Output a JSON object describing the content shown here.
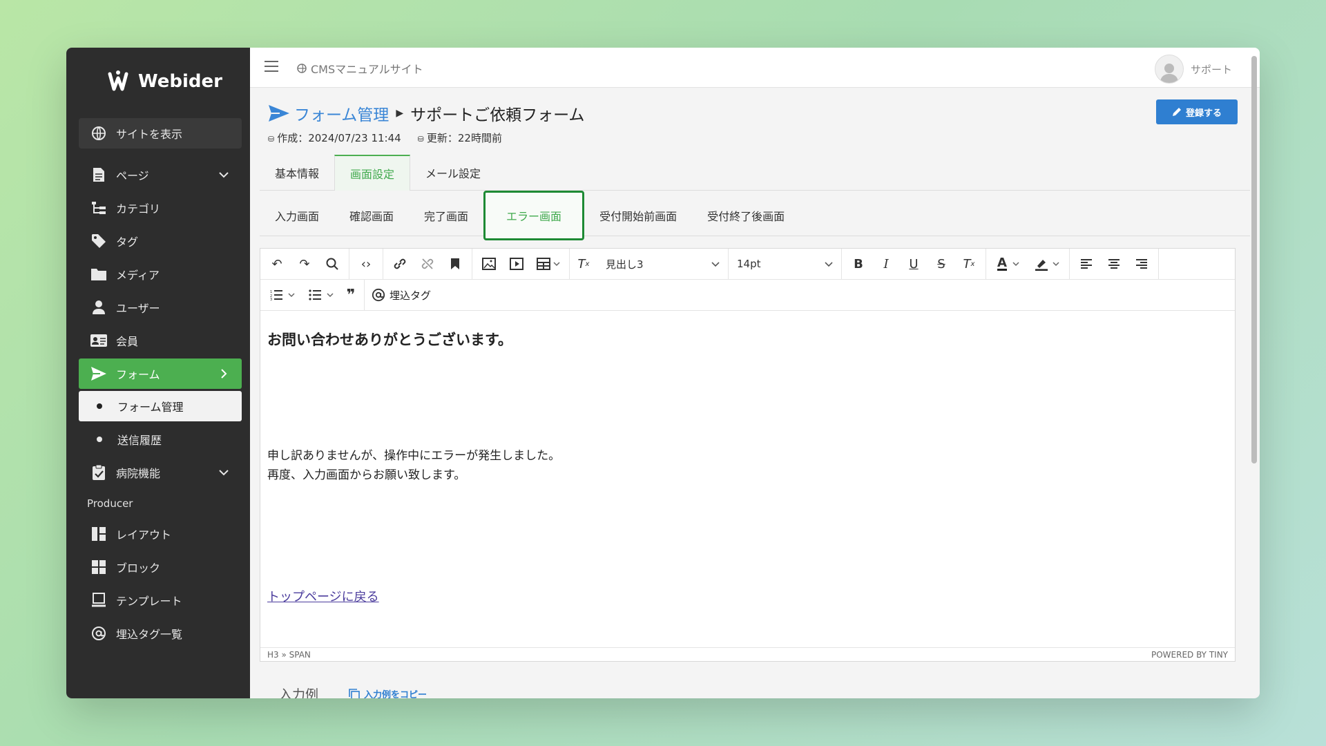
{
  "sidebar": {
    "logo": "Webider",
    "view_site": "サイトを表示",
    "items": [
      {
        "label": "ページ",
        "icon": "document-icon"
      },
      {
        "label": "カテゴリ",
        "icon": "tree-icon"
      },
      {
        "label": "タグ",
        "icon": "tag-icon"
      },
      {
        "label": "メディア",
        "icon": "folder-icon"
      },
      {
        "label": "ユーザー",
        "icon": "user-icon"
      },
      {
        "label": "会員",
        "icon": "id-card-icon"
      },
      {
        "label": "フォーム",
        "icon": "send-icon"
      },
      {
        "label": "フォーム管理"
      },
      {
        "label": "送信履歴"
      },
      {
        "label": "病院機能",
        "icon": "clipboard-check-icon"
      }
    ],
    "section_producer": "Producer",
    "producer_items": [
      {
        "label": "レイアウト",
        "icon": "layout-icon"
      },
      {
        "label": "ブロック",
        "icon": "blocks-icon"
      },
      {
        "label": "テンプレート",
        "icon": "template-icon"
      },
      {
        "label": "埋込タグ一覧",
        "icon": "at-icon"
      }
    ]
  },
  "topbar": {
    "site_name": "CMSマニュアルサイト",
    "user": "サポート"
  },
  "header": {
    "breadcrumb_parent": "フォーム管理",
    "page_title": "サポートご依頼フォーム",
    "created": "作成：2024/07/23 11:44",
    "updated": "更新：22時間前",
    "register_button": "登録する"
  },
  "tabs_main": [
    "基本情報",
    "画面設定",
    "メール設定"
  ],
  "tabs_screen": [
    "入力画面",
    "確認画面",
    "完了画面",
    "エラー画面",
    "受付開始前画面",
    "受付終了後画面"
  ],
  "toolbar": {
    "block_format": "見出し3",
    "font_size": "14pt",
    "embed_tag": "埋込タグ"
  },
  "editor_content": {
    "heading": "お問い合わせありがとうございます。",
    "line1": "申し訳ありませんが、操作中にエラーが発生しました。",
    "line2": "再度、入力画面からお願い致します。",
    "link": "トップページに戻る"
  },
  "statusbar": {
    "path": "H3 » SPAN",
    "powered": "POWERED BY TINY"
  },
  "below": {
    "label": "入力例",
    "copy": "入力例をコピー"
  },
  "colors": {
    "accent_green": "#4caf50",
    "primary_blue": "#2f7fd1",
    "sidebar_bg": "#2d2d2d"
  }
}
